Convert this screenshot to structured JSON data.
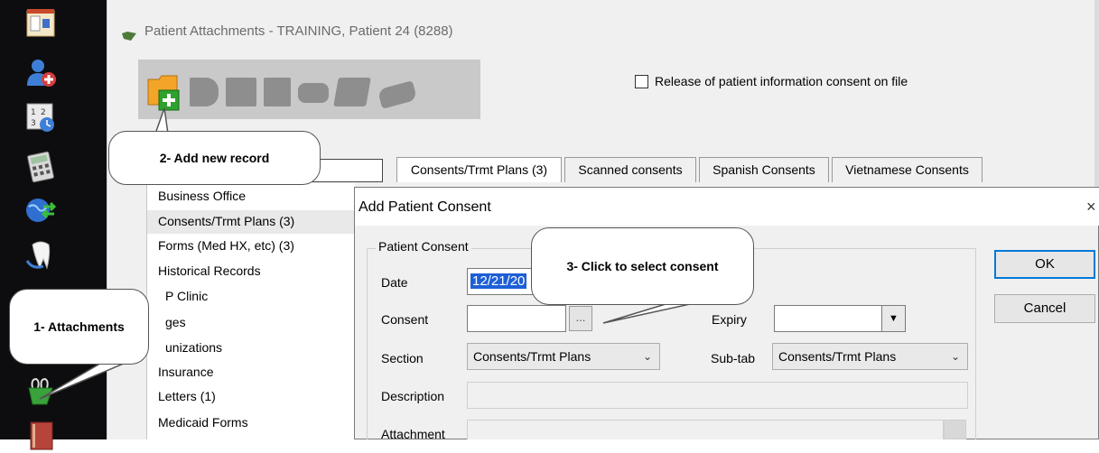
{
  "window": {
    "title": "Patient Attachments - TRAINING, Patient 24 (8288)",
    "release_consent_label": "Release of patient information consent on file"
  },
  "toolbar_icons": [
    "chart-icon",
    "add-patient-icon",
    "calendar-icon",
    "calculator-icon",
    "globe-icon",
    "tooth-icon",
    "binder-clip-icon",
    "book-icon"
  ],
  "tabs": [
    {
      "label": "Consents/Trmt Plans (3)",
      "active": true
    },
    {
      "label": "Scanned consents",
      "active": false
    },
    {
      "label": "Spanish Consents",
      "active": false
    },
    {
      "label": "Vietnamese Consents",
      "active": false
    }
  ],
  "categories": [
    "Business Office",
    "Consents/Trmt Plans (3)",
    "Forms (Med HX, etc) (3)",
    "Historical Records",
    "P Clinic",
    "ges",
    "unizations",
    "Insurance",
    "Letters (1)",
    "Medicaid Forms"
  ],
  "dialog": {
    "title": "Add Patient Consent",
    "close_glyph": "×",
    "group_label": "Patient Consent",
    "date_label": "Date",
    "date_value": "12/21/20",
    "consent_label": "Consent",
    "consent_value": "",
    "ellipsis": "...",
    "expiry_label": "Expiry",
    "expiry_value": "",
    "section_label": "Section",
    "section_value": "Consents/Trmt Plans",
    "subtab_label": "Sub-tab",
    "subtab_value": "Consents/Trmt Plans",
    "description_label": "Description",
    "attachment_label": "Attachment",
    "ok_label": "OK",
    "cancel_label": "Cancel"
  },
  "callouts": {
    "attachments": "1- Attachments",
    "add_new": "2- Add new record",
    "select_consent": "3- Click to select consent"
  },
  "colors": {
    "toolbar_bg": "#0d0d0f",
    "selection_blue": "#1e5fd6",
    "ok_border": "#0078d7",
    "add_icon_green": "#2ea12e",
    "folder_orange": "#f3a52a"
  }
}
